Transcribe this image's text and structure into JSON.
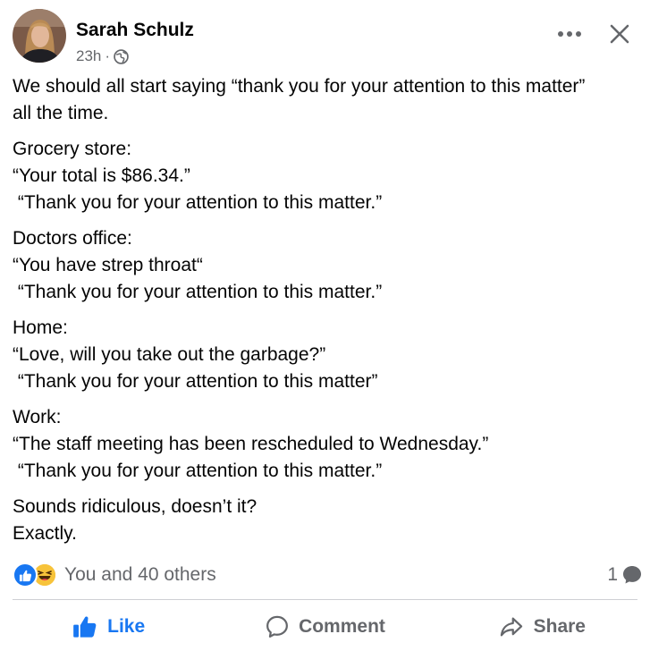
{
  "post": {
    "author": "Sarah Schulz",
    "timestamp": "23h",
    "separator": "·",
    "privacy_icon": "globe-icon",
    "paragraphs": [
      {
        "lines": [
          "We should all start saying “thank you for your attention to this matter”",
          "all the time."
        ]
      },
      {
        "lines": [
          "Grocery store:",
          "“Your total is $86.34.”",
          " “Thank you for your attention to this matter.”"
        ]
      },
      {
        "lines": [
          "Doctors office:",
          "“You have strep throat“",
          " “Thank you for your attention to this matter.”"
        ]
      },
      {
        "lines": [
          "Home:",
          "“Love, will you take out the garbage?”",
          " “Thank you for your attention to this matter”"
        ]
      },
      {
        "lines": [
          "Work:",
          "“The staff meeting has been rescheduled to Wednesday.”",
          " “Thank you for your attention to this matter.”"
        ]
      },
      {
        "lines": [
          "Sounds ridiculous, doesn’t it?",
          "Exactly."
        ]
      }
    ]
  },
  "reactions": {
    "icons": [
      "like-icon",
      "haha-icon"
    ],
    "summary": "You and 40 others",
    "comment_count": "1"
  },
  "actions": {
    "like": "Like",
    "comment": "Comment",
    "share": "Share"
  },
  "colors": {
    "accent": "#1877f2",
    "secondary_text": "#65676b",
    "divider": "#ced0d4"
  }
}
